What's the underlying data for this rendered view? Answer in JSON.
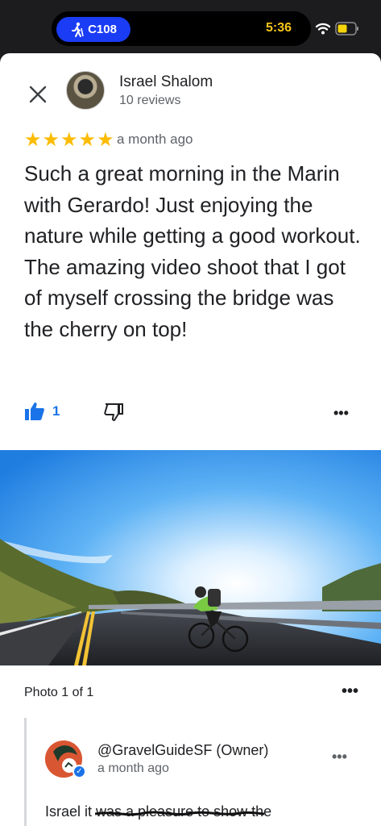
{
  "status_bar": {
    "nav_label": "C108",
    "time": "5:36",
    "icons": [
      "walking-icon",
      "wifi-icon",
      "battery-icon"
    ],
    "accent_color": "#1a3cf5",
    "time_color": "#f5c51b"
  },
  "review": {
    "reviewer_name": "Israel Shalom",
    "reviewer_meta": "10 reviews",
    "rating": 5,
    "stars": [
      "★",
      "★",
      "★",
      "★",
      "★"
    ],
    "star_color": "#fbbc04",
    "time": "a month ago",
    "text": "Such a great morning in the Marin with Gerardo! Just enjoying the nature while getting a good workout. The amazing video shoot that I got of myself crossing the bridge was the cherry on top!",
    "like_count": "1",
    "more_label": "•••"
  },
  "photo": {
    "caption": "Photo 1 of 1",
    "more_label": "•••"
  },
  "owner_reply": {
    "name": "@GravelGuideSF (Owner)",
    "time": "a month ago",
    "more_label": "•••",
    "text": "Israel it was a pleasure to show the"
  }
}
